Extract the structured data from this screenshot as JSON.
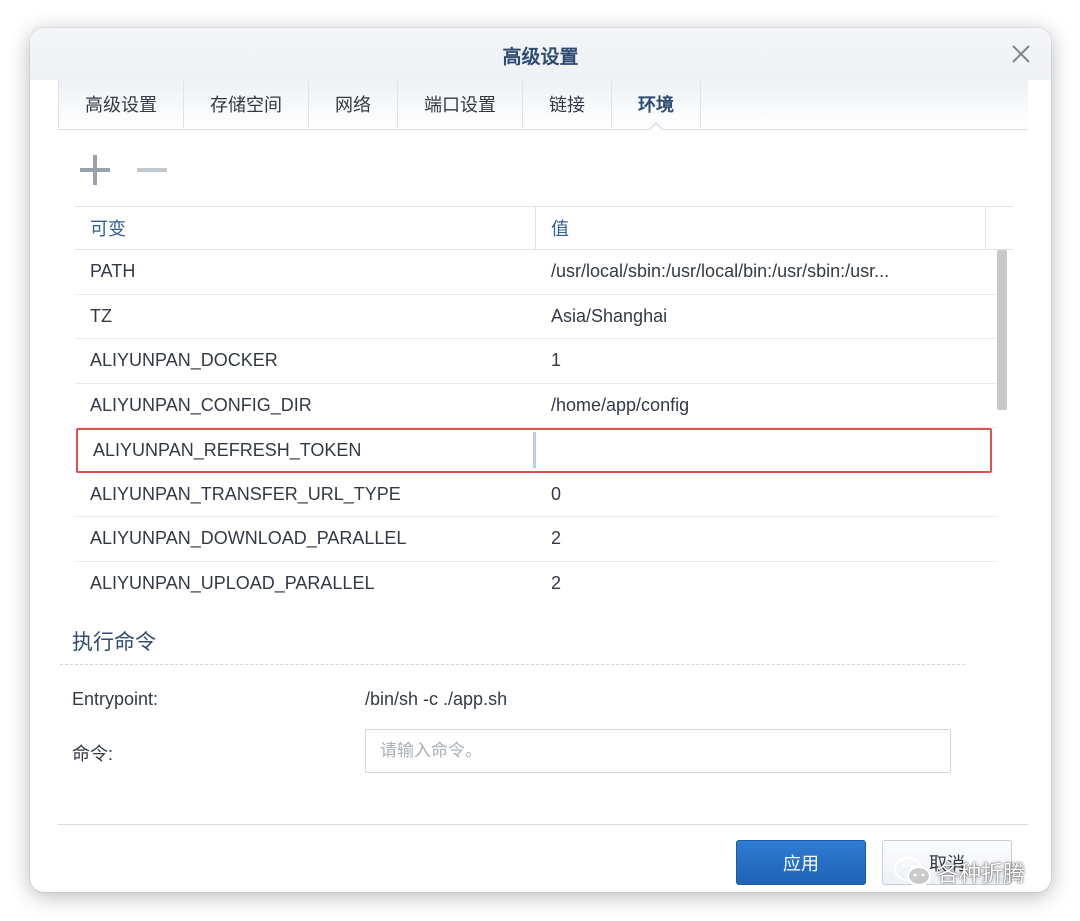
{
  "window": {
    "title": "高级设置"
  },
  "tabs": [
    {
      "label": "高级设置",
      "active": false
    },
    {
      "label": "存储空间",
      "active": false
    },
    {
      "label": "网络",
      "active": false
    },
    {
      "label": "端口设置",
      "active": false
    },
    {
      "label": "链接",
      "active": false
    },
    {
      "label": "环境",
      "active": true
    }
  ],
  "toolbar": {
    "add_icon": "plus-icon",
    "remove_icon": "minus-icon"
  },
  "env_table": {
    "columns": {
      "name": "可变",
      "value": "值"
    },
    "rows": [
      {
        "name": "PATH",
        "value": "/usr/local/sbin:/usr/local/bin:/usr/sbin:/usr..."
      },
      {
        "name": "TZ",
        "value": "Asia/Shanghai"
      },
      {
        "name": "ALIYUNPAN_DOCKER",
        "value": "1"
      },
      {
        "name": "ALIYUNPAN_CONFIG_DIR",
        "value": "/home/app/config"
      },
      {
        "name": "ALIYUNPAN_REFRESH_TOKEN",
        "value": ""
      },
      {
        "name": "ALIYUNPAN_TRANSFER_URL_TYPE",
        "value": "0"
      },
      {
        "name": "ALIYUNPAN_DOWNLOAD_PARALLEL",
        "value": "2"
      },
      {
        "name": "ALIYUNPAN_UPLOAD_PARALLEL",
        "value": "2"
      }
    ]
  },
  "exec_section": {
    "title": "执行命令",
    "entrypoint_label": "Entrypoint:",
    "entrypoint_value": "/bin/sh -c ./app.sh",
    "command_label": "命令:",
    "command_placeholder": "请输入命令。"
  },
  "footer": {
    "apply_label": "应用",
    "cancel_label": "取消"
  },
  "watermark": {
    "text": "各种折腾"
  },
  "colors": {
    "accent": "#2f4c73",
    "primary_button": "#2472c8",
    "highlight_border": "#e05050"
  }
}
